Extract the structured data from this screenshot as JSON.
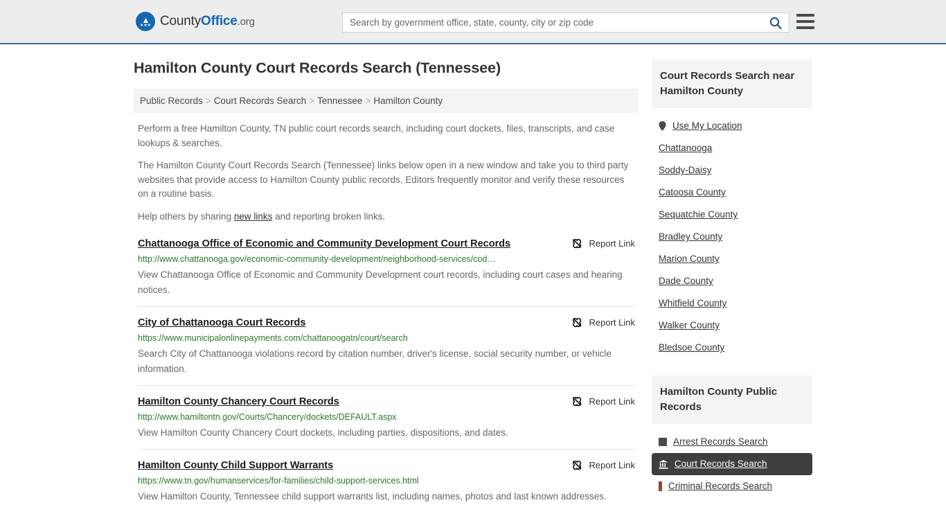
{
  "header": {
    "brand": {
      "county": "County",
      "office": "Office",
      "tld": ".org"
    },
    "search": {
      "placeholder": "Search by government office, state, county, city or zip code",
      "value": ""
    },
    "icons": {
      "search": "search-icon",
      "menu": "hamburger-menu-icon"
    }
  },
  "main": {
    "title": "Hamilton County Court Records Search (Tennessee)",
    "breadcrumb": [
      "Public Records",
      "Court Records Search",
      "Tennessee",
      "Hamilton County"
    ],
    "breadcrumb_separator": ">",
    "intro_paragraphs": [
      "Perform a free Hamilton County, TN public court records search, including court dockets, files, transcripts, and case lookups & searches.",
      "The Hamilton County Court Records Search (Tennessee) links below open in a new window and take you to third party websites that provide access to Hamilton County public records. Editors frequently monitor and verify these resources on a routine basis."
    ],
    "share_prefix": "Help others by sharing ",
    "share_link": "new links",
    "share_suffix": " and reporting broken links.",
    "report_link_label": "Report Link",
    "results": [
      {
        "title": "Chattanooga Office of Economic and Community Development Court Records",
        "url": "http://www.chattanooga.gov/economic-community-development/neighborhood-services/cod…",
        "description": "View Chattanooga Office of Economic and Community Development court records, including court cases and hearing notices."
      },
      {
        "title": "City of Chattanooga Court Records",
        "url": "https://www.municipalonlinepayments.com/chattanoogatn/court/search",
        "description": "Search City of Chattanooga violations record by citation number, driver's license, social security number, or vehicle information."
      },
      {
        "title": "Hamilton County Chancery Court Records",
        "url": "http://www.hamiltontn.gov/Courts/Chancery/dockets/DEFAULT.aspx",
        "description": "View Hamilton County Chancery Court dockets, including parties, dispositions, and dates."
      },
      {
        "title": "Hamilton County Child Support Warrants",
        "url": "https://www.tn.gov/humanservices/for-families/child-support-services.html",
        "description": "View Hamilton County, Tennessee child support warrants list, including names, photos and last known addresses."
      }
    ]
  },
  "sidebar": {
    "nearby": {
      "heading": "Court Records Search near Hamilton County",
      "items": [
        {
          "label": "Use My Location",
          "icon": "map-pin-icon"
        },
        {
          "label": "Chattanooga",
          "icon": ""
        },
        {
          "label": "Soddy-Daisy",
          "icon": ""
        },
        {
          "label": "Catoosa County",
          "icon": ""
        },
        {
          "label": "Sequatchie County",
          "icon": ""
        },
        {
          "label": "Bradley County",
          "icon": ""
        },
        {
          "label": "Marion County",
          "icon": ""
        },
        {
          "label": "Dade County",
          "icon": ""
        },
        {
          "label": "Whitfield County",
          "icon": ""
        },
        {
          "label": "Walker County",
          "icon": ""
        },
        {
          "label": "Bledsoe County",
          "icon": ""
        }
      ]
    },
    "public_records": {
      "heading": "Hamilton County Public Records",
      "items": [
        {
          "label": "Arrest Records Search",
          "icon": "square-icon",
          "active": false
        },
        {
          "label": "Court Records Search",
          "icon": "courthouse-icon",
          "active": true
        },
        {
          "label": "Criminal Records Search",
          "icon": "bar-icon",
          "active": false
        }
      ]
    }
  },
  "colors": {
    "accent_blue": "#1565b0",
    "header_bg": "#eceded",
    "header_border": "#3a6ea5",
    "url_green": "#2a7a2a",
    "active_bg": "#3e3e3e"
  }
}
